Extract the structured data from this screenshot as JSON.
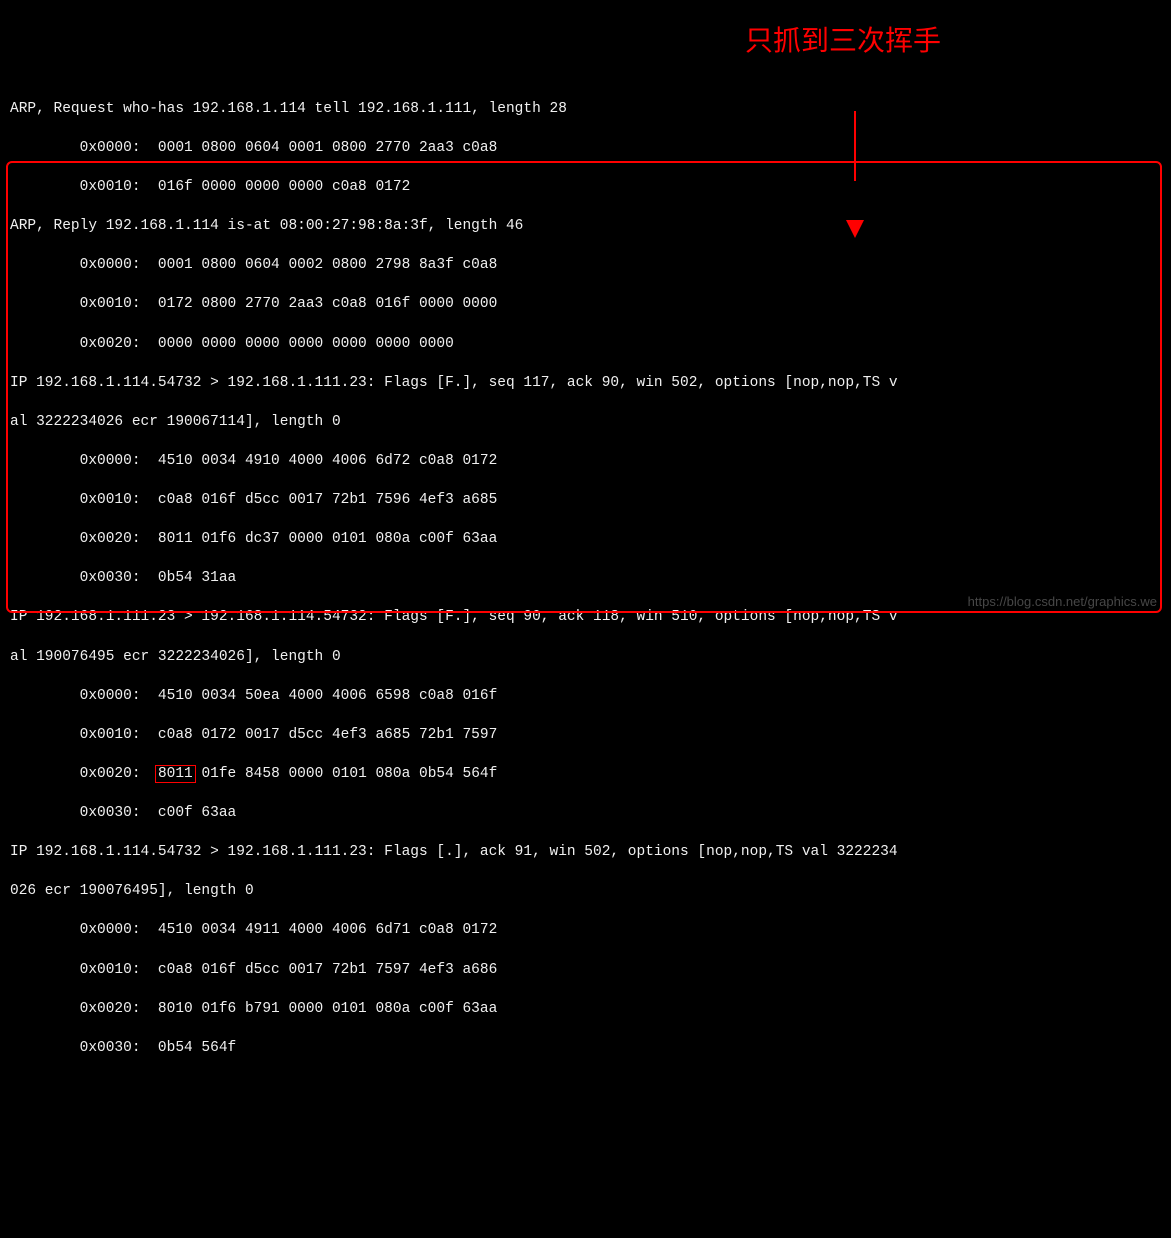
{
  "annotation": {
    "text": "只抓到三次挥手"
  },
  "watermark": "https://blog.csdn.net/graphics.we",
  "packets": {
    "arp_request": {
      "summary": "ARP, Request who-has 192.168.1.114 tell 192.168.1.111, length 28",
      "hex": [
        "        0x0000:  0001 0800 0604 0001 0800 2770 2aa3 c0a8",
        "        0x0010:  016f 0000 0000 0000 c0a8 0172"
      ]
    },
    "arp_reply": {
      "summary": "ARP, Reply 192.168.1.114 is-at 08:00:27:98:8a:3f, length 46",
      "hex": [
        "        0x0000:  0001 0800 0604 0002 0800 2798 8a3f c0a8",
        "        0x0010:  0172 0800 2770 2aa3 c0a8 016f 0000 0000",
        "        0x0020:  0000 0000 0000 0000 0000 0000 0000"
      ]
    },
    "ip1": {
      "summary_a": "IP 192.168.1.114.54732 > 192.168.1.111.23: Flags [F.], seq 117, ack 90, win 502, options [nop,nop,TS v",
      "summary_b": "al 3222234026 ecr 190067114], length 0",
      "hex": [
        "        0x0000:  4510 0034 4910 4000 4006 6d72 c0a8 0172",
        "        0x0010:  c0a8 016f d5cc 0017 72b1 7596 4ef3 a685",
        "        0x0020:  8011 01f6 dc37 0000 0101 080a c00f 63aa",
        "        0x0030:  0b54 31aa"
      ]
    },
    "ip2": {
      "summary_a": "IP 192.168.1.111.23 > 192.168.1.114.54732: Flags [F.], seq 90, ack 118, win 510, options [nop,nop,TS v",
      "summary_b": "al 190076495 ecr 3222234026], length 0",
      "hex0": "        0x0000:  4510 0034 50ea 4000 4006 6598 c0a8 016f",
      "hex1": "        0x0010:  c0a8 0172 0017 d5cc 4ef3 a685 72b1 7597",
      "hex2_pre": "        0x0020:  ",
      "hex2_box": "8011",
      "hex2_post": " 01fe 8458 0000 0101 080a 0b54 564f",
      "hex3": "        0x0030:  c00f 63aa"
    },
    "ip3": {
      "summary_a": "IP 192.168.1.114.54732 > 192.168.1.111.23: Flags [.], ack 91, win 502, options [nop,nop,TS val 3222234",
      "summary_b": "026 ecr 190076495], length 0",
      "hex": [
        "        0x0000:  4510 0034 4911 4000 4006 6d71 c0a8 0172",
        "        0x0010:  c0a8 016f d5cc 0017 72b1 7597 4ef3 a686",
        "        0x0020:  8010 01f6 b791 0000 0101 080a c00f 63aa",
        "        0x0030:  0b54 564f"
      ]
    }
  }
}
